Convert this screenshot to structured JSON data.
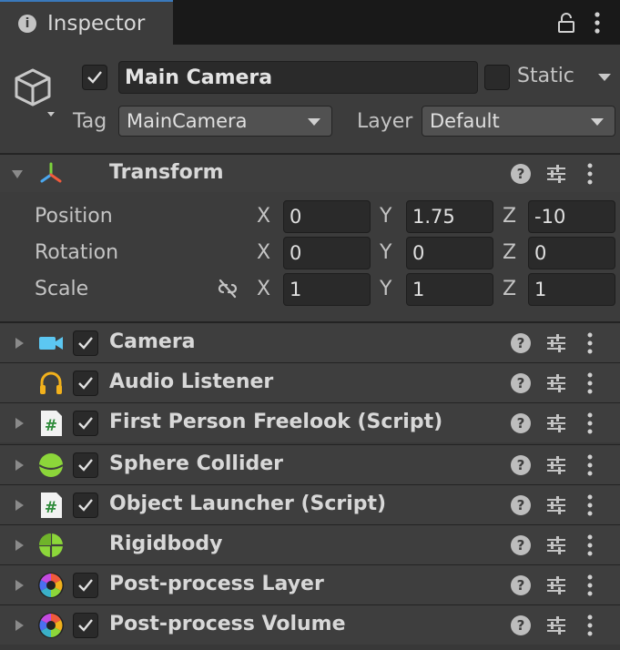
{
  "tab": {
    "title": "Inspector"
  },
  "gameobject": {
    "active": true,
    "name": "Main Camera",
    "static_label": "Static",
    "static": false,
    "tag_label": "Tag",
    "tag_value": "MainCamera",
    "layer_label": "Layer",
    "layer_value": "Default"
  },
  "transform": {
    "title": "Transform",
    "rows": [
      {
        "label": "Position",
        "x": "0",
        "y": "1.75",
        "z": "-10"
      },
      {
        "label": "Rotation",
        "x": "0",
        "y": "0",
        "z": "0"
      },
      {
        "label": "Scale",
        "x": "1",
        "y": "1",
        "z": "1"
      }
    ],
    "axes": {
      "x": "X",
      "y": "Y",
      "z": "Z"
    }
  },
  "components": [
    {
      "name": "Camera",
      "icon": "camera-icon",
      "enabled": true,
      "has_foldout": true,
      "has_checkbox": true
    },
    {
      "name": "Audio Listener",
      "icon": "headphones-icon",
      "enabled": true,
      "has_foldout": false,
      "has_checkbox": true
    },
    {
      "name": "First Person Freelook (Script)",
      "icon": "script-icon",
      "enabled": true,
      "has_foldout": true,
      "has_checkbox": true
    },
    {
      "name": "Sphere Collider",
      "icon": "sphere-collider-icon",
      "enabled": true,
      "has_foldout": true,
      "has_checkbox": true
    },
    {
      "name": "Object Launcher (Script)",
      "icon": "script-icon",
      "enabled": true,
      "has_foldout": true,
      "has_checkbox": true
    },
    {
      "name": "Rigidbody",
      "icon": "rigidbody-icon",
      "enabled": true,
      "has_foldout": true,
      "has_checkbox": false
    },
    {
      "name": "Post-process Layer",
      "icon": "post-process-icon",
      "enabled": true,
      "has_foldout": true,
      "has_checkbox": true
    },
    {
      "name": "Post-process Volume",
      "icon": "post-process-icon",
      "enabled": true,
      "has_foldout": true,
      "has_checkbox": true
    }
  ],
  "colors": {
    "accent": "#3a79bb",
    "panel": "#3c3c3c",
    "field": "#2a2a2a",
    "camera_icon": "#5cc7f2",
    "headphones_icon": "#f2b11c",
    "sphere_icon": "#8cd63a",
    "script_icon_text": "#2e8b3a"
  }
}
